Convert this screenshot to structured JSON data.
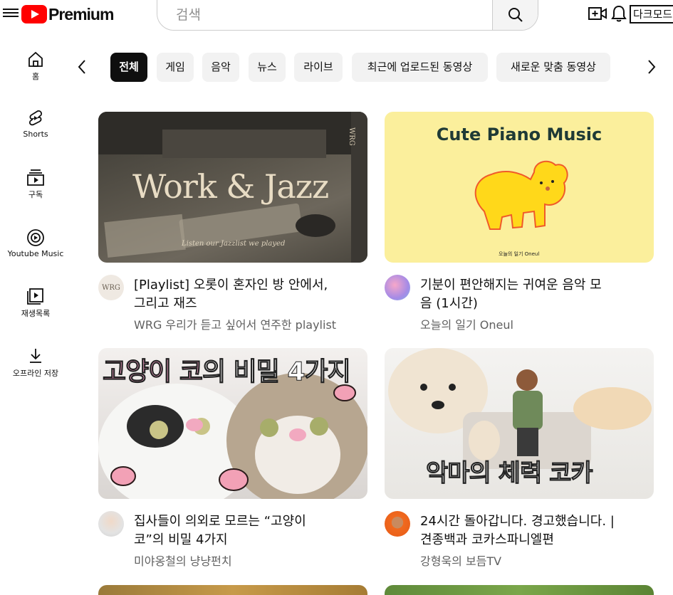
{
  "header": {
    "logo_text": "Premium",
    "search_placeholder": "검색",
    "dark_mode_label": "다크모드"
  },
  "sidebar": [
    {
      "label": "홈",
      "icon": "home-icon"
    },
    {
      "label": "Shorts",
      "icon": "shorts-icon"
    },
    {
      "label": "구독",
      "icon": "subscriptions-icon"
    },
    {
      "label": "Youtube Music",
      "icon": "music-icon"
    },
    {
      "label": "재생목록",
      "icon": "playlist-icon"
    },
    {
      "label": "오프라인 저장",
      "icon": "download-icon"
    }
  ],
  "chips": [
    "전체",
    "게임",
    "음악",
    "뉴스",
    "라이브",
    "최근에 업로드된 동영상",
    "새로운 맞춤 동영상"
  ],
  "videos": [
    {
      "title_line1": "[Playlist] 오롯이 혼자인 방 안에서,",
      "title_line2": "그리고 재즈",
      "channel": "WRG 우리가 듣고 싶어서 연주한 playlist",
      "thumb_title": "Work & Jazz",
      "thumb_sub": "Listen our Jazzlist we played",
      "thumb_tag": "WRG",
      "avatar_text": "WRG"
    },
    {
      "title_line1": "기분이 편안해지는 귀여운 음악 모",
      "title_line2": "음 (1시간)",
      "channel": "오늘의 일기 Oneul",
      "thumb_title": "Cute Piano Music",
      "thumb_sub": "오늘의 일기 Oneul"
    },
    {
      "title_line1": "집사들이 의외로 모르는 “고양이",
      "title_line2": "코”의 비밀 4가지",
      "channel": "미야옹철의 냥냥펀치",
      "thumb_title_a": "고양이 코",
      "thumb_title_b": "의 비밀 4가지"
    },
    {
      "title_line1": "24시간 돌아갑니다. 경고했습니다. |",
      "title_line2": "견종백과 코카스파니엘편",
      "channel": "강형욱의 보듬TV",
      "thumb_title": "악마의 체력 코카"
    }
  ]
}
